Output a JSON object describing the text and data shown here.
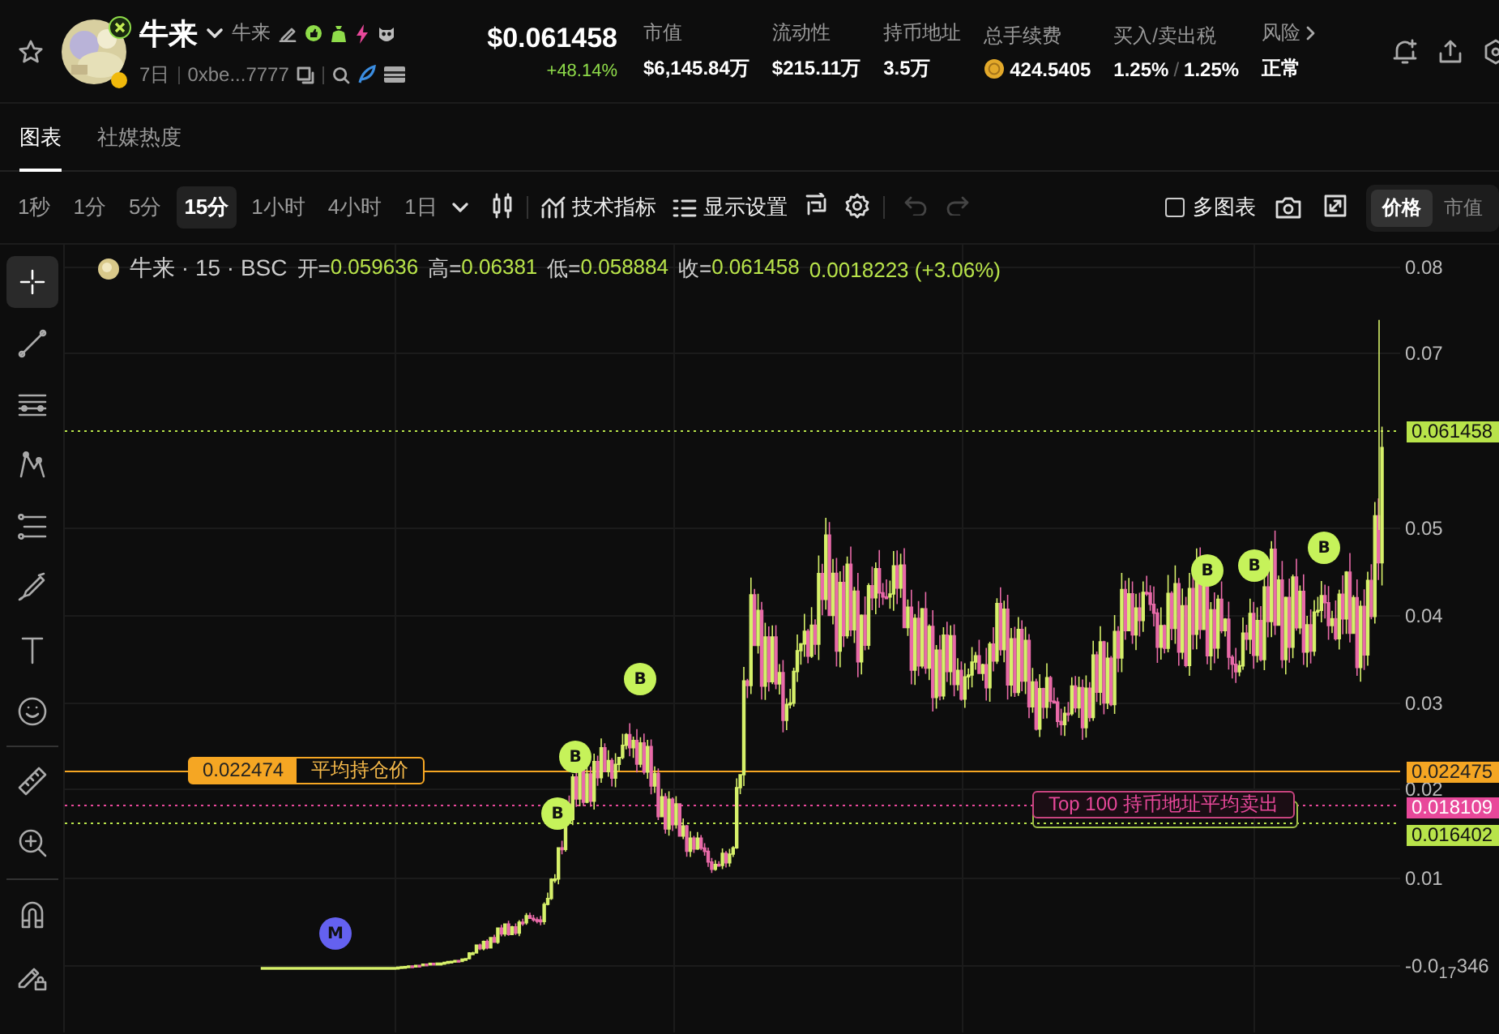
{
  "token": {
    "name": "牛来",
    "alias": "牛来",
    "age": "7日",
    "address": "0xbe...7777",
    "price": "$0.061458",
    "change": "+48.14%"
  },
  "stats": [
    {
      "label": "市值",
      "value": "$6,145.84万",
      "kind": "plain"
    },
    {
      "label": "流动性",
      "value": "$215.11万",
      "kind": "plain"
    },
    {
      "label": "持币地址",
      "value": "3.5万",
      "kind": "plain"
    },
    {
      "label": "总手续费",
      "value": "424.5405",
      "kind": "coin"
    },
    {
      "label": "买入/卖出税",
      "value": "1.25%",
      "separator": "/",
      "value2": "1.25%",
      "kind": "pair"
    },
    {
      "label": "风险",
      "value": "正常",
      "kind": "link"
    }
  ],
  "tabs": [
    {
      "label": "图表",
      "selected": true
    },
    {
      "label": "社媒热度",
      "selected": false
    }
  ],
  "intervals": [
    {
      "label": "1秒",
      "selected": false
    },
    {
      "label": "1分",
      "selected": false
    },
    {
      "label": "5分",
      "selected": false
    },
    {
      "label": "15分",
      "selected": true
    },
    {
      "label": "1小时",
      "selected": false
    },
    {
      "label": "4小时",
      "selected": false
    },
    {
      "label": "1日",
      "selected": false
    }
  ],
  "toolbar": {
    "indicators": "技术指标",
    "display": "显示设置",
    "multi_chart": {
      "label": "多图表",
      "checked": false
    },
    "undo": {
      "disabled": true
    },
    "redo": {
      "disabled": true
    }
  },
  "scale_modes": [
    {
      "label": "价格",
      "selected": true
    },
    {
      "label": "市值",
      "selected": false
    }
  ],
  "side_tools": [
    {
      "kind": "crosshair",
      "selected": true
    },
    {
      "kind": "line",
      "selected": false
    },
    {
      "kind": "hlines",
      "selected": false
    },
    {
      "kind": "path",
      "selected": false
    },
    {
      "kind": "fib",
      "selected": false
    },
    {
      "kind": "brush",
      "selected": false
    },
    {
      "kind": "text",
      "selected": false
    },
    {
      "kind": "emoji",
      "selected": false
    },
    {
      "kind": "ruler",
      "selected": false
    },
    {
      "kind": "zoom",
      "selected": false
    },
    {
      "kind": "magnet",
      "selected": false
    },
    {
      "kind": "lock",
      "selected": false
    }
  ],
  "legend": {
    "symbol": "牛来 · 15 · BSC",
    "fields": [
      {
        "label": "开=",
        "value": "0.059636"
      },
      {
        "label": "高=",
        "value": "0.06381"
      },
      {
        "label": "低=",
        "value": "0.058884"
      },
      {
        "label": "收=",
        "value": "0.061458"
      }
    ],
    "change": "0.0018223 (+3.06%)"
  },
  "chart": {
    "yticks": [
      "0.08",
      "0.07",
      "0.05",
      "0.04",
      "0.03",
      "0.02",
      "0.01",
      "-0.0$_{17}$346"
    ],
    "current_price": "0.061458",
    "avg_hold": {
      "value": "0.022474",
      "label": "平均持仓价",
      "axis": "0.022475"
    },
    "top100_sell": {
      "label": "Top 100 持币地址平均卖出",
      "axis": "0.018109"
    },
    "top100_buy": {
      "axis": "0.016402"
    },
    "markers": [
      {
        "label": "B",
        "kind": "buy"
      },
      {
        "label": "B",
        "kind": "buy"
      },
      {
        "label": "B",
        "kind": "buy"
      },
      {
        "label": "B",
        "kind": "buy"
      },
      {
        "label": "B",
        "kind": "buy"
      },
      {
        "label": "B",
        "kind": "buy"
      },
      {
        "label": "M",
        "kind": "mint"
      }
    ]
  }
}
